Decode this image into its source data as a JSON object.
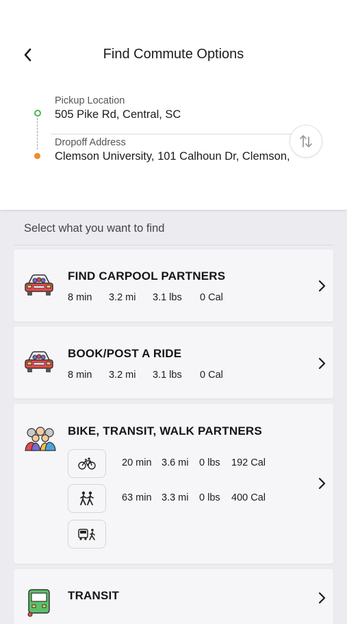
{
  "header": {
    "title": "Find Commute Options",
    "pickup_label": "Pickup Location",
    "pickup_value": "505 Pike Rd, Central, SC",
    "dropoff_label": "Dropoff Address",
    "dropoff_value": "Clemson University, 101 Calhoun Dr, Clemson,"
  },
  "section_label": "Select what you want to find",
  "cards": [
    {
      "title": "FIND CARPOOL PARTNERS",
      "icon": "car-with-passengers-icon",
      "stats": [
        "8 min",
        "3.2 mi",
        "3.1 lbs",
        "0 Cal"
      ]
    },
    {
      "title": "BOOK/POST A RIDE",
      "icon": "car-with-passengers-icon",
      "stats": [
        "8 min",
        "3.2 mi",
        "3.1 lbs",
        "0 Cal"
      ]
    },
    {
      "title": "BIKE, TRANSIT, WALK PARTNERS",
      "icon": "group-of-people-icon",
      "modes": [
        {
          "icon": "bicycle-icon",
          "stats": [
            "20 min",
            "3.6 mi",
            "0 lbs",
            "192 Cal"
          ]
        },
        {
          "icon": "walking-people-icon",
          "stats": [
            "63 min",
            "3.3 mi",
            "0 lbs",
            "400 Cal"
          ]
        },
        {
          "icon": "bus-walk-icon",
          "stats": []
        }
      ]
    },
    {
      "title": "TRANSIT",
      "icon": "bus-icon"
    }
  ],
  "colors": {
    "pickup_dot": "#49b84c",
    "dropoff_dot": "#ef8b2c",
    "background": "#ececf0",
    "card": "#f6f6f8"
  }
}
